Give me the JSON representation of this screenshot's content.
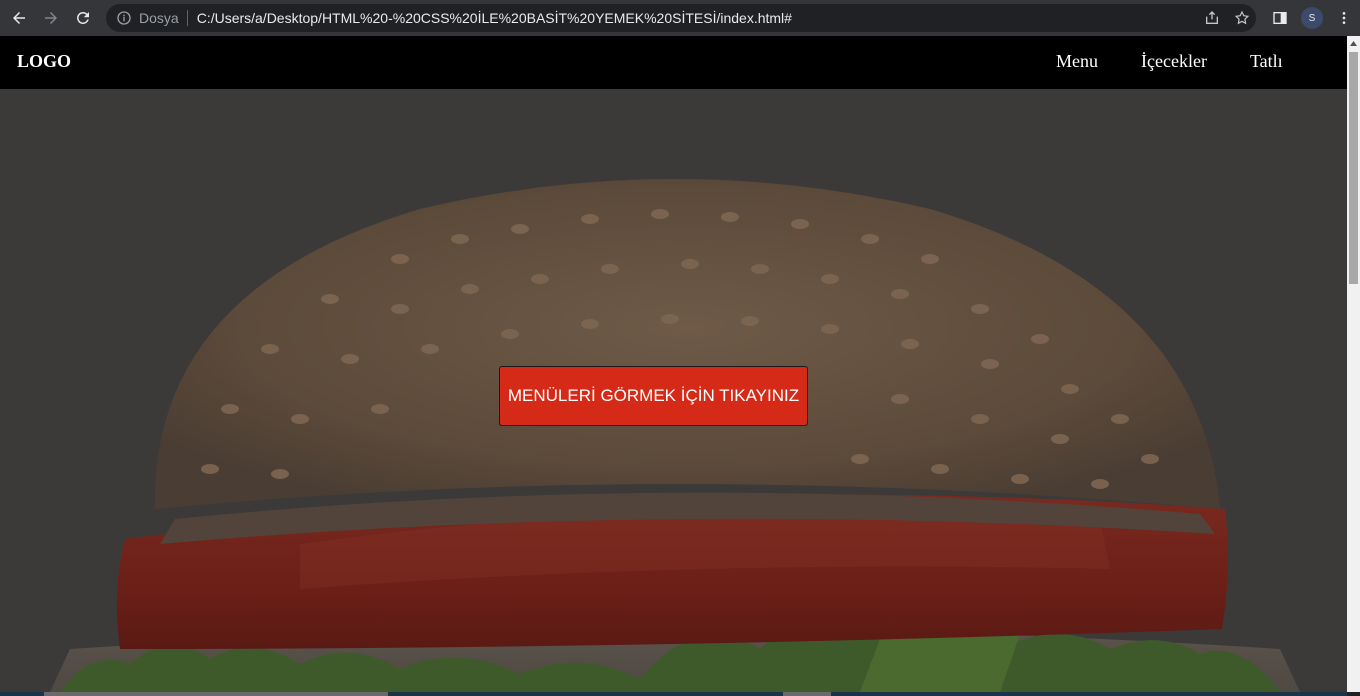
{
  "browser": {
    "security_label": "Dosya",
    "url": "C:/Users/a/Desktop/HTML%20-%20CSS%20İLE%20BASİT%20YEMEK%20SİTESİ/index.html#",
    "profile_initial": "S"
  },
  "site": {
    "logo": "LOGO",
    "nav": [
      {
        "label": "Menu"
      },
      {
        "label": "İçecekler"
      },
      {
        "label": "Tatlı"
      }
    ]
  },
  "hero": {
    "button_label": "MENÜLERİ GÖRMEK İÇİN TIKAYINIZ",
    "image": "hamburger-photo"
  },
  "colors": {
    "navbar_bg": "#000000",
    "cta_bg": "#d42a17",
    "chrome_bg": "#35363a"
  }
}
